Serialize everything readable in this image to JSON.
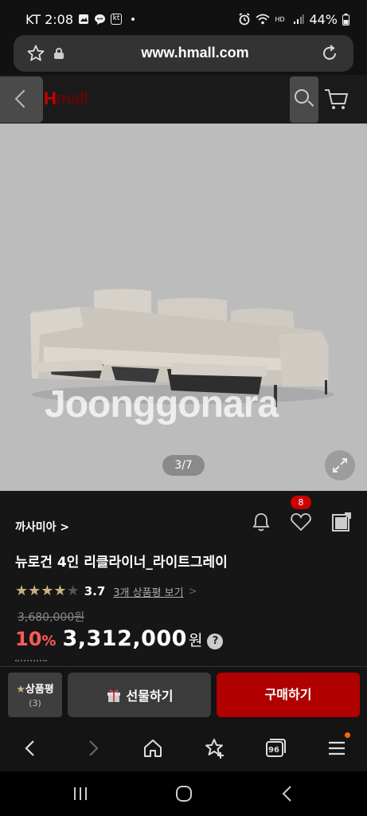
{
  "status_bar": {
    "carrier_time": "KT 2:08",
    "battery": "44%",
    "icons": [
      "image-icon",
      "chat-icon",
      "kt-icon",
      "alarm-icon",
      "wifi-icon",
      "hd-icon",
      "signal-icon",
      "battery-icon"
    ],
    "kt_label": "kt",
    "hd_label": "HD"
  },
  "url_bar": {
    "url": "www.hmall.com",
    "icons": [
      "bookmark-star-icon",
      "lock-icon",
      "reload-icon"
    ]
  },
  "site_header": {
    "logo_h": "H",
    "logo_rest": "mall",
    "icons": [
      "back-chevron-icon",
      "search-icon",
      "cart-icon"
    ]
  },
  "product_image": {
    "watermark": "Joonggonara",
    "counter": "3/7",
    "alt_subject": "reclining sofa"
  },
  "product": {
    "brand": "까사미아",
    "brand_chevron": ">",
    "wishlist_count": "8",
    "title": "뉴로건 4인 리클라이너_라이트그레이",
    "rating": "3.7",
    "stars_full": 4,
    "stars_total": 5,
    "review_link": "3개 상품평 보기",
    "review_chevron": ">",
    "original_price": "3,680,000원",
    "discount": "10",
    "discount_unit": "%",
    "price": "3,312,000",
    "price_unit": "원",
    "help": "?"
  },
  "action_bar": {
    "review_label": "상품평",
    "review_star": "★",
    "review_count": "(3)",
    "gift_label": "선물하기",
    "buy_label": "구매하기"
  },
  "browser_nav": {
    "items": [
      "back-icon",
      "forward-icon",
      "home-icon",
      "bookmarks-icon",
      "tabs-icon",
      "menu-icon"
    ],
    "tabs_count": "96"
  },
  "system_nav": {
    "items": [
      "recents-icon",
      "home-circle-icon",
      "system-back-icon"
    ]
  },
  "colors": {
    "accent_red": "#b00000",
    "discount_red": "#ff5a5a",
    "star_gold": "#c9b27a",
    "background": "#161616"
  }
}
